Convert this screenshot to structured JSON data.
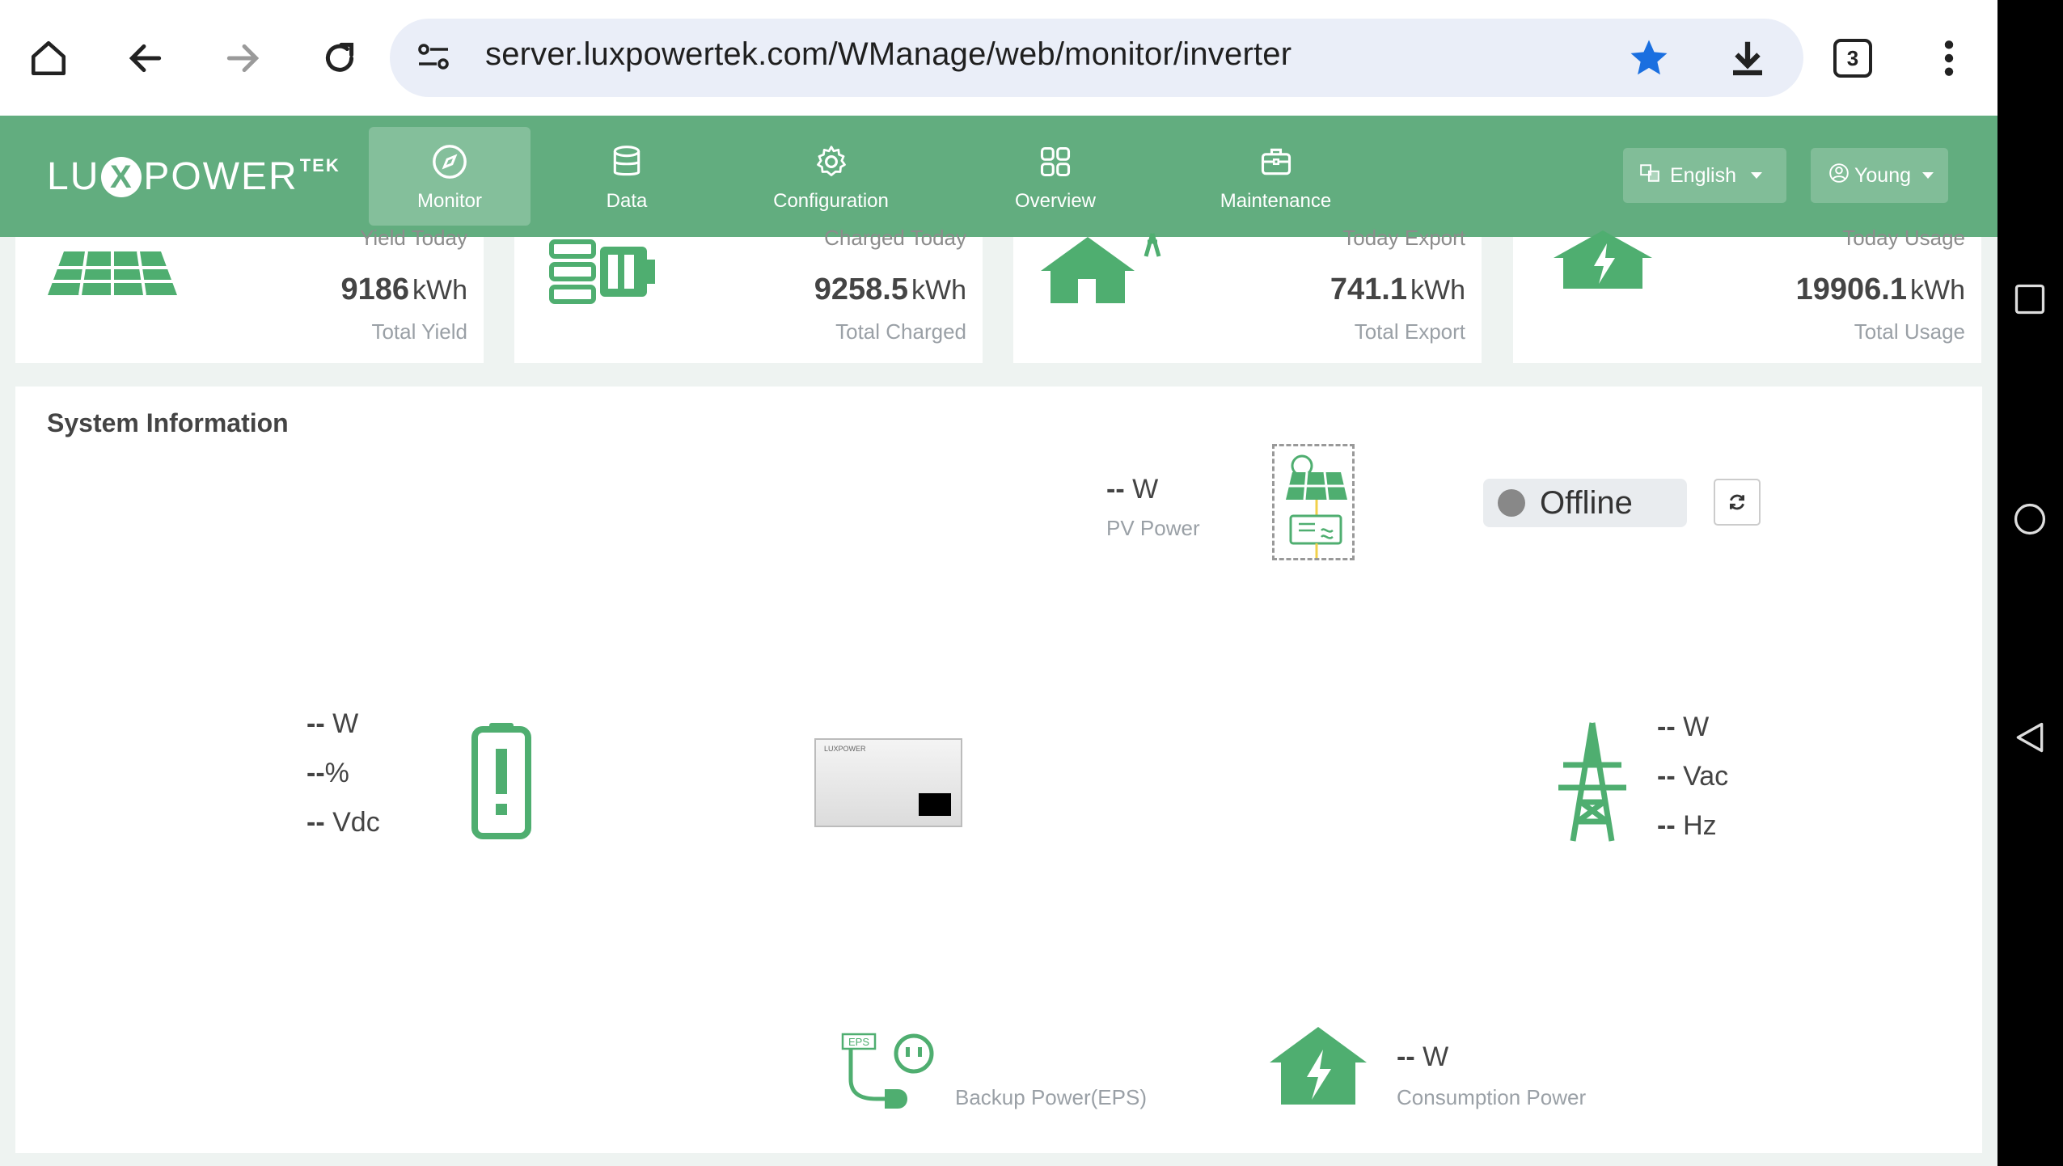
{
  "browser": {
    "url": "server.luxpowertek.com/WManage/web/monitor/inverter",
    "tab_count": "3"
  },
  "header": {
    "logo": {
      "lu": "LU",
      "x": "X",
      "power": "POWER",
      "tek": "TEK"
    },
    "nav": [
      {
        "label": "Monitor",
        "active": true
      },
      {
        "label": "Data"
      },
      {
        "label": "Configuration"
      },
      {
        "label": "Overview"
      },
      {
        "label": "Maintenance"
      }
    ],
    "language": "English",
    "user": "Young"
  },
  "stats": [
    {
      "cut_label": "Yield Today",
      "value": "9186",
      "unit": "kWh",
      "label": "Total Yield"
    },
    {
      "cut_label": "Charged Today",
      "value": "9258.5",
      "unit": "kWh",
      "label": "Total Charged"
    },
    {
      "cut_label": "Today Export",
      "value": "741.1",
      "unit": "kWh",
      "label": "Total Export"
    },
    {
      "cut_label": "Today Usage",
      "value": "19906.1",
      "unit": "kWh",
      "label": "Total Usage"
    }
  ],
  "system": {
    "title": "System Information",
    "pv": {
      "value": "--",
      "unit": "W",
      "label": "PV Power"
    },
    "status": "Offline",
    "battery": {
      "power": "--",
      "power_unit": "W",
      "soc": "--",
      "soc_unit": "%",
      "voltage": "--",
      "voltage_unit": "Vdc"
    },
    "grid": {
      "power": "--",
      "power_unit": "W",
      "voltage": "--",
      "voltage_unit": "Vac",
      "freq": "--",
      "freq_unit": "Hz"
    },
    "eps": {
      "label": "Backup Power(EPS)",
      "badge": "EPS"
    },
    "consumption": {
      "value": "--",
      "unit": "W",
      "label": "Consumption Power"
    },
    "inverter_label": "LUXPOWER"
  },
  "colors": {
    "brand_green": "#62ad7f",
    "icon_green": "#4fae70",
    "star_blue": "#1a6fe0"
  }
}
